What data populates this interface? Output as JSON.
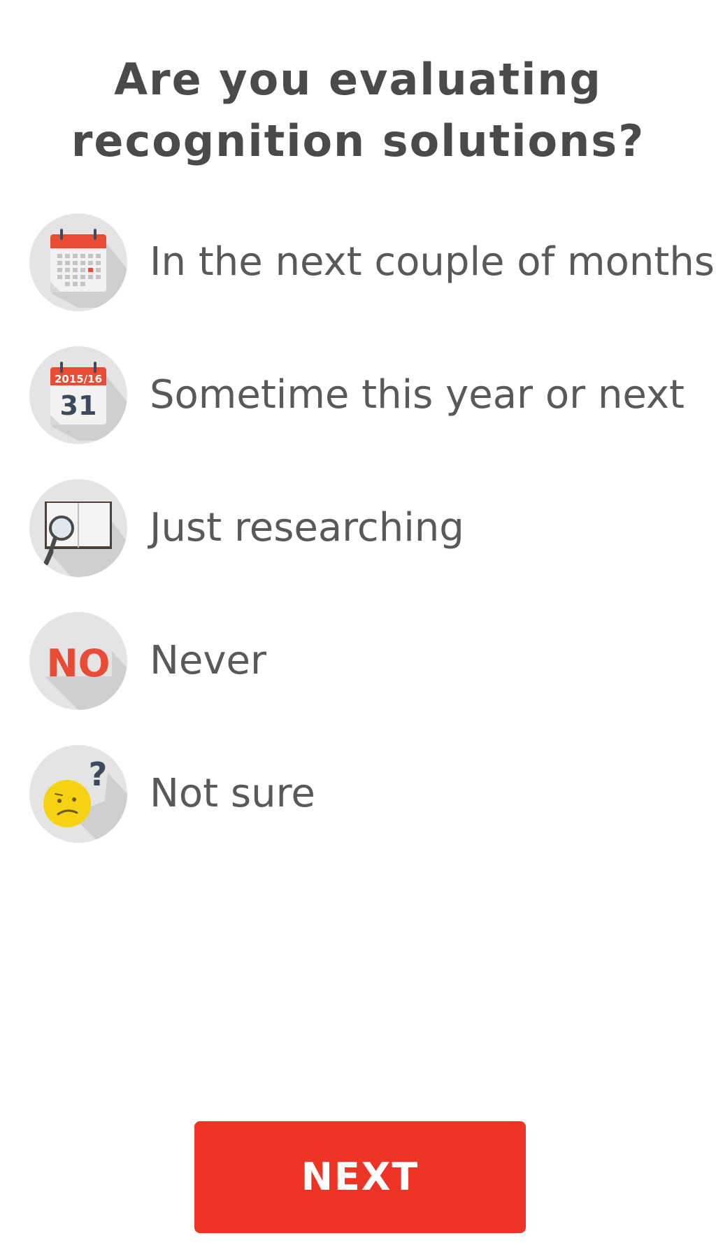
{
  "question": {
    "line1": "Are you evaluating",
    "line2": "recognition solutions?"
  },
  "options": [
    {
      "label": "In the next couple of months",
      "icon": "calendar-grid-icon"
    },
    {
      "label": "Sometime this year or next",
      "icon": "calendar-date-icon",
      "icon_text_top": "2015/16",
      "icon_text_day": "31"
    },
    {
      "label": "Just researching",
      "icon": "book-magnifier-icon"
    },
    {
      "label": "Never",
      "icon": "no-icon",
      "icon_text": "NO"
    },
    {
      "label": "Not sure",
      "icon": "confused-face-icon",
      "icon_text": "?"
    }
  ],
  "next_button": {
    "label": "NEXT"
  },
  "colors": {
    "accent": "#ee3424",
    "text": "#595959",
    "icon_bg": "#e4e4e4",
    "icon_red": "#e94b35",
    "icon_navy": "#3d4a5c",
    "emoji_yellow": "#f5d314"
  }
}
